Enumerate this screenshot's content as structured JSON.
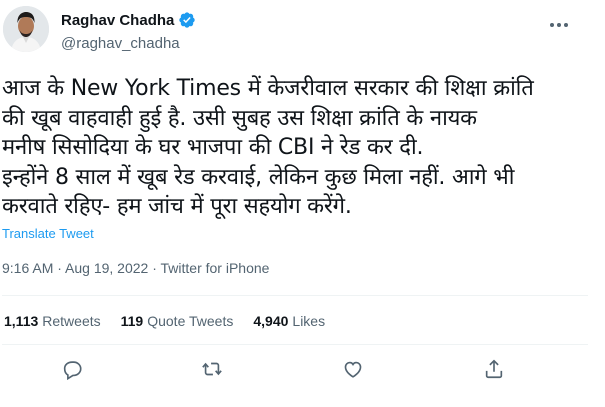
{
  "author": {
    "name": "Raghav Chadha",
    "handle": "@raghav_chadha",
    "verified_color": "#1d9bf0"
  },
  "tweet": {
    "lines": [
      "आज के New York Times में केजरीवाल सरकार की शिक्षा क्रांति",
      "की खूब वाहवाही हुई है. उसी सुबह उस शिक्षा क्रांति के नायक",
      "मनीष सिसोदिया के घर भाजपा की CBI ने रेड कर दी.",
      "इन्होंने 8 साल में खूब रेड करवाई, लेकिन कुछ मिला नहीं. आगे भी",
      "करवाते रहिए- हम जांच में पूरा सहयोग करेंगे."
    ],
    "translate_label": "Translate Tweet",
    "timestamp": "9:16 AM · Aug 19, 2022 · Twitter for iPhone"
  },
  "stats": {
    "retweets_count": "1,113",
    "retweets_label": "Retweets",
    "quotes_count": "119",
    "quotes_label": "Quote Tweets",
    "likes_count": "4,940",
    "likes_label": "Likes"
  },
  "actions": [
    "reply-icon",
    "retweet-icon",
    "like-icon",
    "share-icon"
  ],
  "colors": {
    "accent": "#1d9bf0",
    "secondary_text": "#536471",
    "divider": "#eff3f4"
  }
}
